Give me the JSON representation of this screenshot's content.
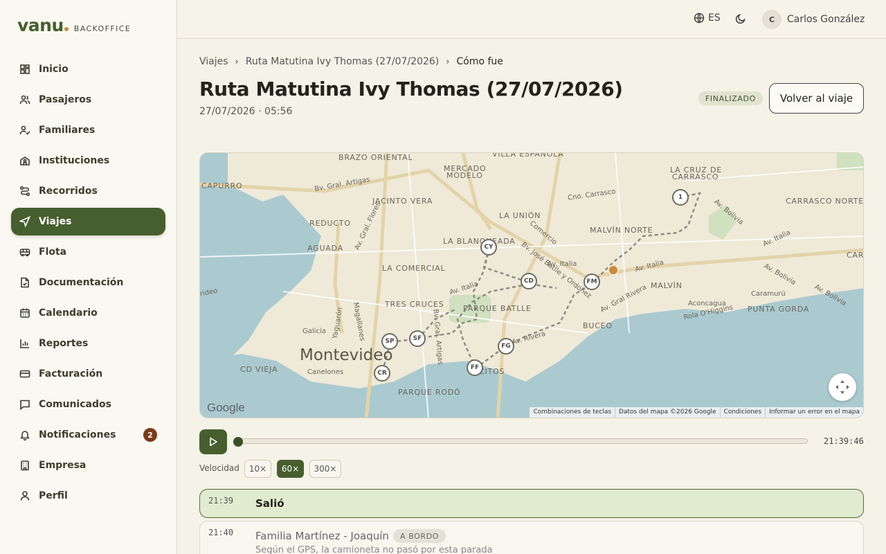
{
  "brand": {
    "name": "vanu",
    "subtitle": "BACKOFFICE"
  },
  "sidebar": {
    "items": [
      {
        "label": "Inicio",
        "icon": "dashboard-icon"
      },
      {
        "label": "Pasajeros",
        "icon": "users-icon"
      },
      {
        "label": "Familiares",
        "icon": "family-icon"
      },
      {
        "label": "Instituciones",
        "icon": "school-icon"
      },
      {
        "label": "Recorridos",
        "icon": "route-icon"
      },
      {
        "label": "Viajes",
        "icon": "navigation-icon",
        "active": true
      },
      {
        "label": "Flota",
        "icon": "bus-icon"
      },
      {
        "label": "Documentación",
        "icon": "document-icon"
      },
      {
        "label": "Calendario",
        "icon": "calendar-icon"
      },
      {
        "label": "Reportes",
        "icon": "chart-icon"
      },
      {
        "label": "Facturación",
        "icon": "credit-card-icon"
      },
      {
        "label": "Comunicados",
        "icon": "message-icon"
      },
      {
        "label": "Notificaciones",
        "icon": "bell-icon",
        "badge": "2"
      },
      {
        "label": "Empresa",
        "icon": "building-icon"
      },
      {
        "label": "Perfil",
        "icon": "user-icon"
      }
    ]
  },
  "header": {
    "language": "ES",
    "user_initial": "C",
    "user_name": "Carlos González"
  },
  "breadcrumbs": [
    "Viajes",
    "Ruta Matutina Ivy Thomas (27/07/2026)",
    "Cómo fue"
  ],
  "page": {
    "title": "Ruta Matutina Ivy Thomas (27/07/2026)",
    "subtitle": "27/07/2026 · 05:56",
    "status": "FINALIZADO",
    "back_button": "Volver al viaje"
  },
  "map": {
    "city": "Montevideo",
    "neighborhoods": [
      "BRAZO ORIENTAL",
      "VILLA ESPAÑOLA",
      "MERCADO",
      "MODELO",
      "LA CRUZ DE",
      "CARRASCO",
      "CAPURRO",
      "JACINTO VERA",
      "CARRASCO NORTE",
      "REDUCTO",
      "LA UNIÓN",
      "MALVÍN NORTE",
      "AGUADA",
      "LA BLANQUEADA",
      "LA COMERCIAL",
      "MALVÍN",
      "TRES CRUCES",
      "PARQUE BATLLE",
      "PUNTA GORDA",
      "BUCEO",
      "CD VIEJA",
      "PARQUE RODÓ",
      "CITOS",
      "CAR"
    ],
    "streets": [
      "Bv. Gral. Artigas",
      "Cno. Carrasco",
      "Av. Bolivia",
      "Av. Italia",
      "Comercio",
      "Bv. José Batlle y Ordoñez",
      "Av. Gral. Flores",
      "Av. Italia",
      "Av. Italia",
      "Av. Italia",
      "Av. Gral Rivera",
      "Av. Bolivia",
      "Caramurú",
      "Aconcagua",
      "Rola O'Higgins",
      "Magallanes",
      "Yaguarón",
      "Galicia",
      "Canelones",
      "Bv. Gral. Artigas",
      "Av. Rivera",
      "rideo",
      "Av. Bolivia"
    ],
    "stops": [
      "1",
      "CY",
      "CD",
      "FM",
      "SP",
      "SF",
      "FG",
      "FF",
      "CR"
    ],
    "google_logo": "Google",
    "attribution": [
      "Combinaciones de teclas",
      "Datos del mapa ©2026 Google",
      "Condiciones",
      "Informar un error en el mapa"
    ],
    "fullscreen_icon": "fullscreen-icon"
  },
  "player": {
    "time": "21:39:46",
    "progress": 0,
    "speed_label": "Velocidad",
    "speeds": [
      "10×",
      "60×",
      "300×"
    ],
    "active_speed": "60×"
  },
  "timeline": [
    {
      "time": "21:39",
      "title": "Salió",
      "active": true
    },
    {
      "time": "21:40",
      "title": "Familia Martínez - Joaquín",
      "tag": "A BORDO",
      "note": "Según el GPS, la camioneta no pasó por esta parada"
    }
  ],
  "colors": {
    "accent": "#475f2e",
    "badge": "#7a3b1c",
    "bus_marker": "#c98b3c",
    "water": "#aacad0"
  }
}
